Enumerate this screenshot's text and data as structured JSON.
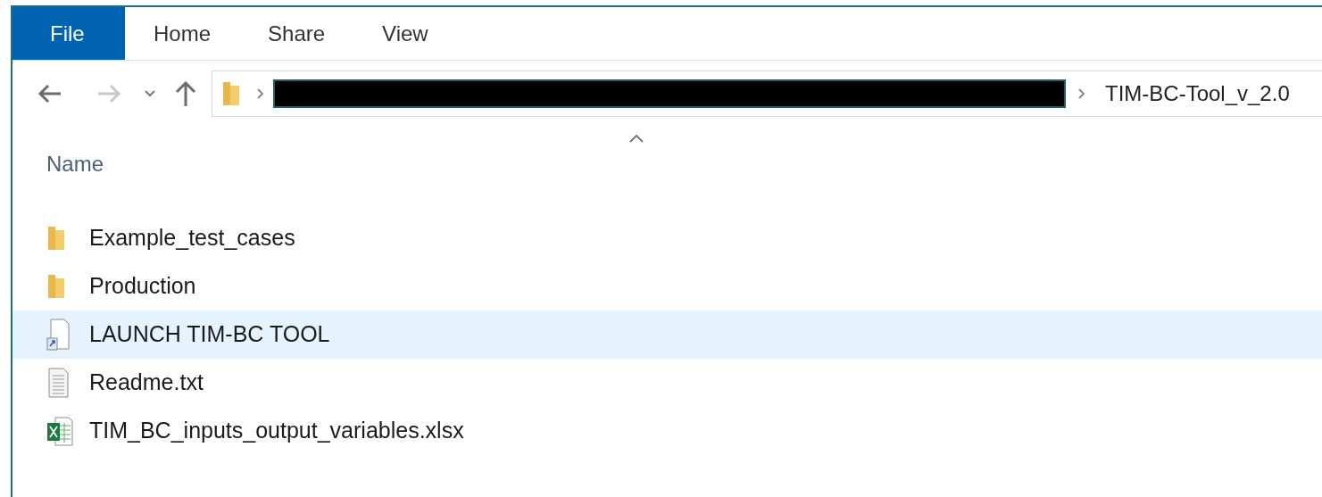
{
  "ribbon_tabs": [
    {
      "label": "File",
      "kind": "menu"
    },
    {
      "label": "Home",
      "kind": "tab"
    },
    {
      "label": "Share",
      "kind": "tab"
    },
    {
      "label": "View",
      "kind": "tab"
    }
  ],
  "address_bar": {
    "current_folder": "TIM-BC-Tool_v_2.0"
  },
  "columns": [
    {
      "label": "Name"
    }
  ],
  "files": [
    {
      "name": "Example_test_cases",
      "kind": "folder",
      "selected": false
    },
    {
      "name": "Production",
      "kind": "folder",
      "selected": false
    },
    {
      "name": "LAUNCH TIM-BC TOOL",
      "kind": "shortcut",
      "selected": true
    },
    {
      "name": "Readme.txt",
      "kind": "text",
      "selected": false
    },
    {
      "name": "TIM_BC_inputs_output_variables.xlsx",
      "kind": "excel",
      "selected": false
    }
  ]
}
